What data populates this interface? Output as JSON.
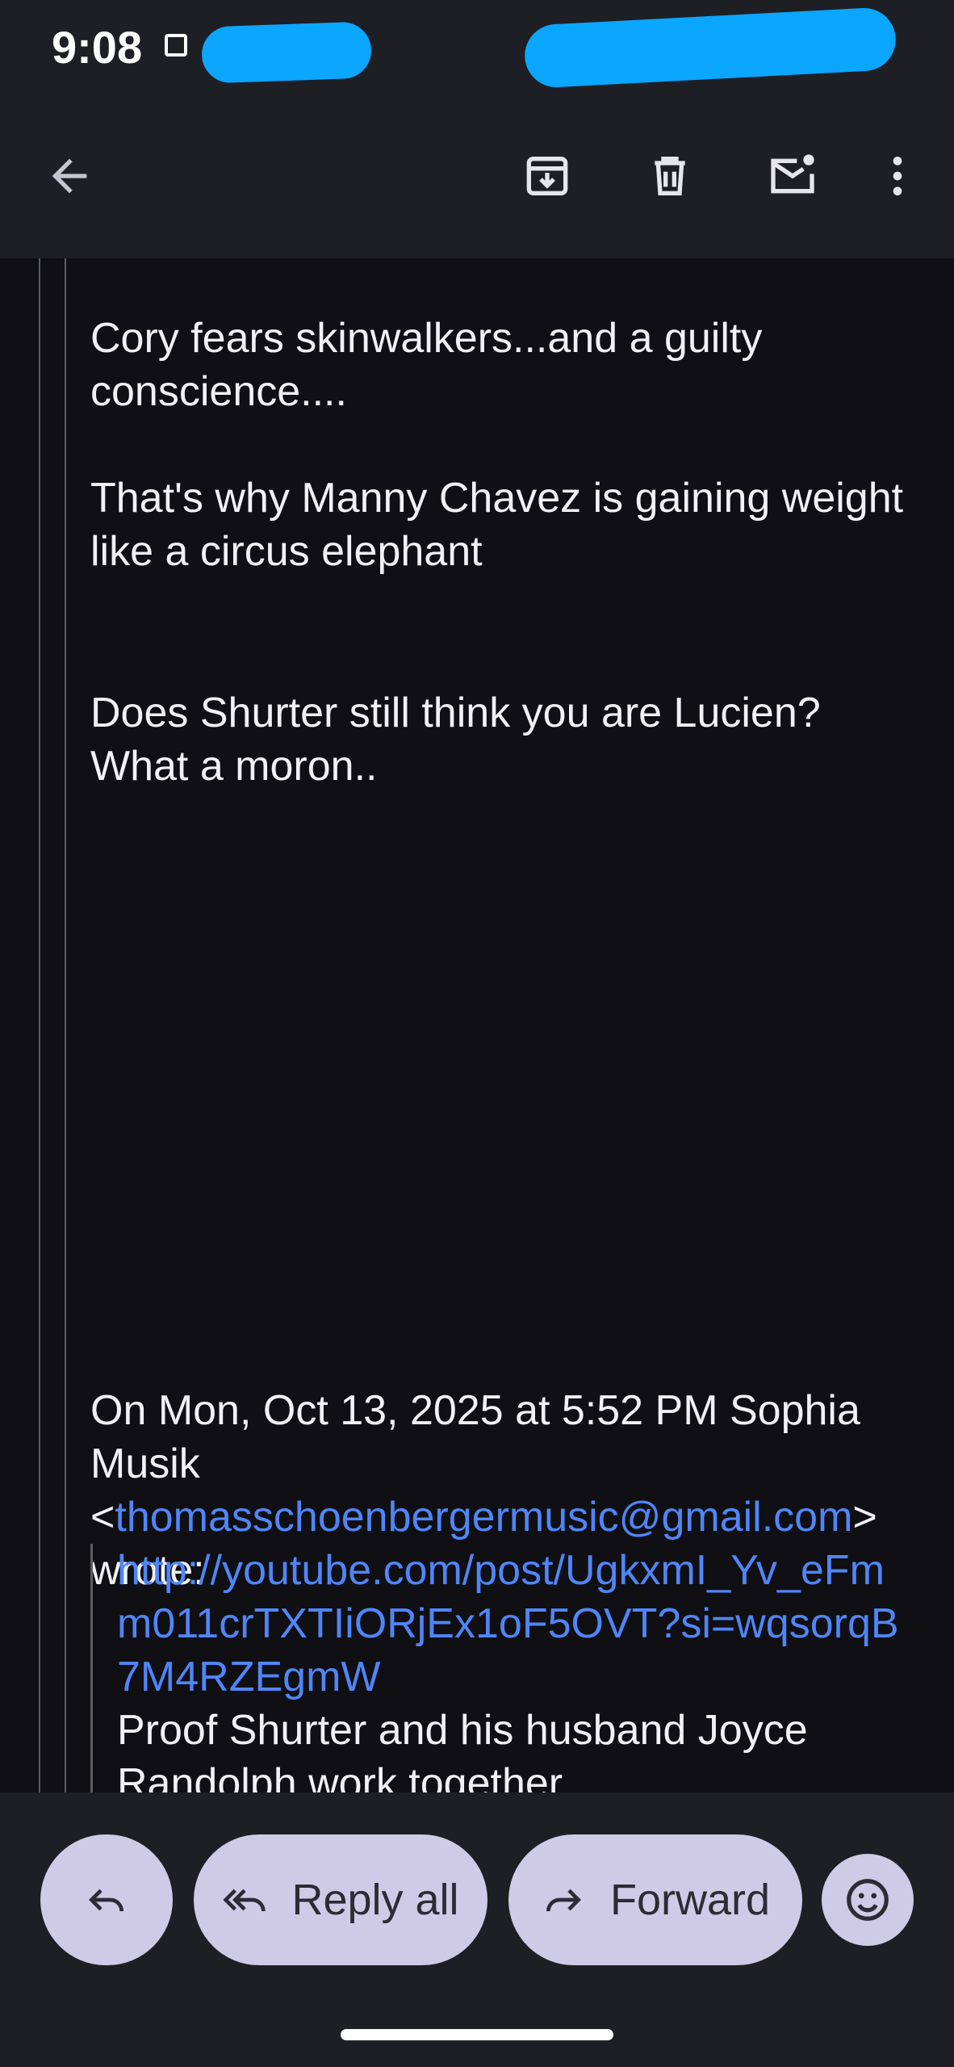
{
  "status_bar": {
    "time": "9:08"
  },
  "toolbar": {
    "icons": [
      "back-arrow-icon",
      "archive-icon",
      "trash-icon",
      "mark-unread-icon",
      "more-vert-icon"
    ]
  },
  "email": {
    "para1": "Cory fears skinwalkers...and a guilty conscience....",
    "para2": "That's why Manny Chavez is gaining weight like a circus elephant",
    "para3": "Does Shurter still think you are Lucien? What a moron..",
    "quote_header": {
      "prefix": "On Mon, Oct 13, 2025 at 5:52 PM Sophia Musik <",
      "email": "thomasschoenbergermusic@gmail.com",
      "suffix": "> wrote:"
    },
    "nested_quote": {
      "url": "http://youtube.com/post/UgkxmI_Yv_eFmm011crTXTIiORjEx1oF5OVT?si=wqsorqB7M4RZEgmW",
      "text": "Proof Shurter and his husband Joyce Randolph work together"
    }
  },
  "actions": {
    "reply_all_label": "Reply all",
    "forward_label": "Forward"
  },
  "colors": {
    "background": "#0f0f14",
    "bar": "#1e1f25",
    "link": "#4f86f7",
    "pill": "#cfcae6"
  }
}
